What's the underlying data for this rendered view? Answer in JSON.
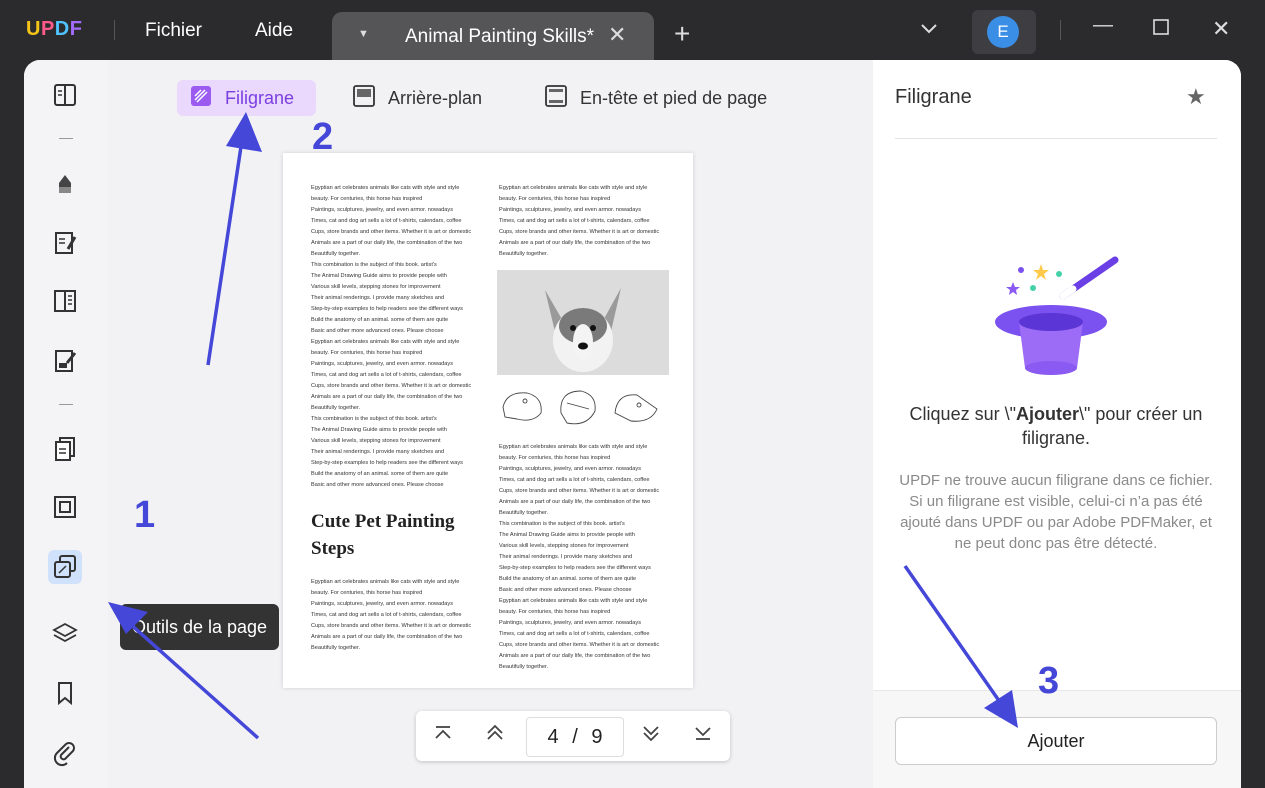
{
  "app": {
    "logo_text": "UPDF",
    "menu": [
      "Fichier",
      "Aide"
    ],
    "doc_tab_title": "Animal Painting Skills*",
    "avatar_letter": "E"
  },
  "sidebar": {
    "tooltip": "Outils de la page"
  },
  "page_tools": {
    "tabs": [
      {
        "label": "Filigrane",
        "active": true
      },
      {
        "label": "Arrière-plan",
        "active": false
      },
      {
        "label": "En-tête et pied de page",
        "active": false
      }
    ]
  },
  "document": {
    "col1_para": "Egyptian art celebrates animals like cats with style and style\nbeauty. For centuries, this horse has inspired\nPaintings, sculptures, jewelry, and even armor. nowadays\nTimes, cat and dog art sells a lot of t-shirts, calendars, coffee\nCups, store brands and other items. Whether it is art or domestic\nAnimals are a part of our daily life, the combination of the two\nBeautifully together.\nThis combination is the subject of this book. artist's\nThe Animal Drawing Guide aims to provide people with\nVarious skill levels, stepping stones for improvement\nTheir animal renderings. I provide many sketches and\nStep-by-step examples to help readers see the different ways\nBuild the anatomy of an animal. some of them are quite\nBasic and other more advanced ones. Please choose\nEgyptian art celebrates animals like cats with style and style\nbeauty. For centuries, this horse has inspired\nPaintings, sculptures, jewelry, and even armor. nowadays\nTimes, cat and dog art sells a lot of t-shirts, calendars, coffee\nCups, store brands and other items. Whether it is art or domestic\nAnimals are a part of our daily life, the combination of the two\nBeautifully together.\nThis combination is the subject of this book. artist's\nThe Animal Drawing Guide aims to provide people with\nVarious skill levels, stepping stones for improvement\nTheir animal renderings. I provide many sketches and\nStep-by-step examples to help readers see the different ways\nBuild the anatomy of an animal. some of them are quite\nBasic and other more advanced ones. Please choose",
    "heading": "Cute Pet Painting Steps",
    "col1_para2": "Egyptian art celebrates animals like cats with style and style\nbeauty. For centuries, this horse has inspired\nPaintings, sculptures, jewelry, and even armor. nowadays\nTimes, cat and dog art sells a lot of t-shirts, calendars, coffee\nCups, store brands and other items. Whether it is art or domestic\nAnimals are a part of our daily life, the combination of the two\nBeautifully together.",
    "col2_para1": "Egyptian art celebrates animals like cats with style and style\nbeauty. For centuries, this horse has inspired\nPaintings, sculptures, jewelry, and even armor. nowadays\nTimes, cat and dog art sells a lot of t-shirts, calendars, coffee\nCups, store brands and other items. Whether it is art or domestic\nAnimals are a part of our daily life, the combination of the two\nBeautifully together.",
    "col2_para2": "Egyptian art celebrates animals like cats with style and style\nbeauty. For centuries, this horse has inspired\nPaintings, sculptures, jewelry, and even armor. nowadays\nTimes, cat and dog art sells a lot of t-shirts, calendars, coffee\nCups, store brands and other items. Whether it is art or domestic\nAnimals are a part of our daily life, the combination of the two\nBeautifully together.\nThis combination is the subject of this book. artist's\nThe Animal Drawing Guide aims to provide people with\nVarious skill levels, stepping stones for improvement\nTheir animal renderings. I provide many sketches and\nStep-by-step examples to help readers see the different ways\nBuild the anatomy of an animal. some of them are quite\nBasic and other more advanced ones. Please choose\nEgyptian art celebrates animals like cats with style and style\nbeauty. For centuries, this horse has inspired\nPaintings, sculptures, jewelry, and even armor. nowadays\nTimes, cat and dog art sells a lot of t-shirts, calendars, coffee\nCups, store brands and other items. Whether it is art or domestic\nAnimals are a part of our daily life, the combination of the two\nBeautifully together."
  },
  "pager": {
    "current": "4",
    "separator": "/",
    "total": "9"
  },
  "right_panel": {
    "title": "Filigrane",
    "main_prefix": "Cliquez sur \\\"",
    "main_bold": "Ajouter",
    "main_suffix": "\\\" pour créer un filigrane.",
    "sub_text": "UPDF ne trouve aucun filigrane dans ce fichier. Si un filigrane est visible, celui-ci n’a pas été ajouté dans UPDF ou par Adobe PDFMaker, et ne peut donc pas être détecté.",
    "add_button": "Ajouter"
  },
  "annotations": [
    "1",
    "2",
    "3"
  ],
  "colors": {
    "accent": "#7a3fe0",
    "annotation": "#4447d8",
    "titlebar": "#2b2b2e"
  }
}
